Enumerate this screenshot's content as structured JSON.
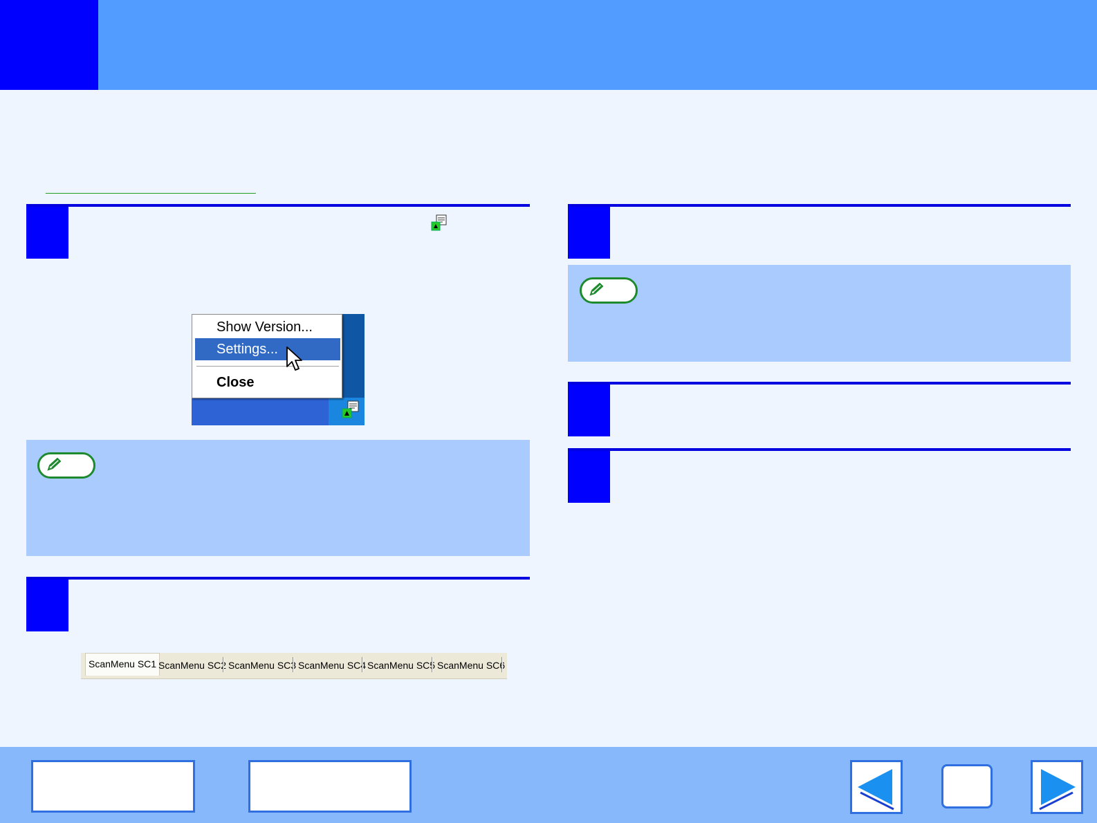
{
  "header": {
    "title": ""
  },
  "intro": {
    "text": "",
    "link_text": ""
  },
  "menu": {
    "items": [
      {
        "label": "Show Version..."
      },
      {
        "label": "Settings..."
      },
      {
        "label": "Close"
      }
    ]
  },
  "tabs": [
    {
      "label": "ScanMenu SC1"
    },
    {
      "label": "ScanMenu SC2"
    },
    {
      "label": "ScanMenu SC3"
    },
    {
      "label": "ScanMenu SC4"
    },
    {
      "label": "ScanMenu SC5"
    },
    {
      "label": "ScanMenu SC6"
    }
  ],
  "icons": {
    "tray_icon": "scanner-tray-icon",
    "note_icon": "pencil-icon",
    "cursor": "mouse-pointer-icon",
    "nav_back": "back-arrow-icon",
    "nav_forward": "forward-arrow-icon"
  },
  "colors": {
    "header_blue": "#529bff",
    "accent_blue": "#0000ff",
    "note_background": "#a9cbfe",
    "page_background": "#eef5fe",
    "footer_background": "#86b8fb",
    "menu_highlight": "#316ac5"
  }
}
